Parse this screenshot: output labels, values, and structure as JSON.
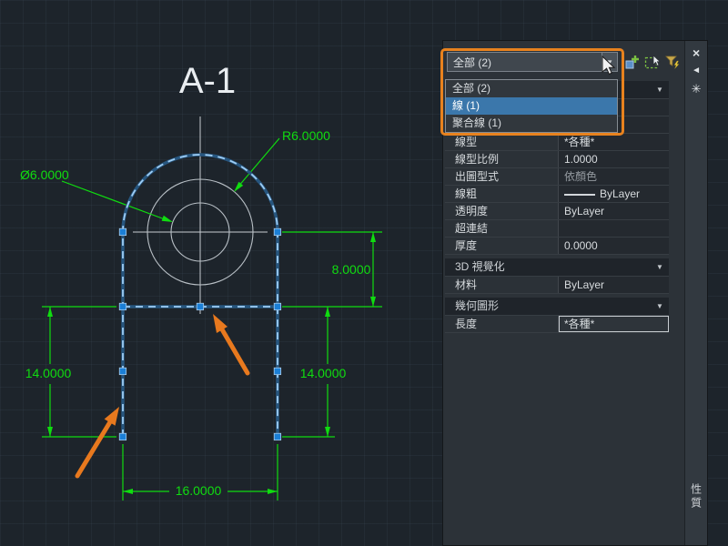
{
  "canvas": {
    "title": "A-1",
    "dimensions": {
      "radius": "R6.0000",
      "diameter": "Ø6.0000",
      "vertical_right_upper": "8.0000",
      "vertical_left": "14.0000",
      "vertical_right_lower": "14.0000",
      "horizontal_bottom": "16.0000"
    },
    "colors": {
      "background": "#1d242b",
      "dimension_green": "#10dc10",
      "selection_blue": "#9fcef5",
      "grip_blue": "#1b7fd6",
      "annotation_orange": "#e8791e"
    }
  },
  "palette": {
    "selector": {
      "value": "全部 (2)",
      "options": [
        "全部 (2)",
        "線 (1)",
        "聚合線 (1)"
      ],
      "highlighted_option": "線 (1)"
    },
    "toolbar": {
      "icons": [
        "toggle-pickadd",
        "select-objects",
        "quick-select"
      ]
    },
    "window_controls": {
      "close": "×",
      "auto_hide": "◄",
      "settings": "✳"
    },
    "icons": {
      "collapse": "▼",
      "combo_arrow": "▼"
    },
    "sections": [
      {
        "header": "",
        "rows": [
          {
            "label": "",
            "value": ""
          },
          {
            "label": "",
            "value": ""
          },
          {
            "label": "線型",
            "value": "*各種*"
          },
          {
            "label": "線型比例",
            "value": "1.0000"
          },
          {
            "label": "出圖型式",
            "value": "依顏色"
          },
          {
            "label": "線粗",
            "value": "ByLayer"
          },
          {
            "label": "透明度",
            "value": "ByLayer"
          },
          {
            "label": "超連結",
            "value": ""
          },
          {
            "label": "厚度",
            "value": "0.0000"
          }
        ]
      },
      {
        "header": "3D 視覺化",
        "rows": [
          {
            "label": "材料",
            "value": "ByLayer"
          }
        ]
      },
      {
        "header": "幾何圖形",
        "rows": [
          {
            "label": "長度",
            "value": "*各種*"
          }
        ]
      }
    ],
    "tab_label": "性質"
  }
}
